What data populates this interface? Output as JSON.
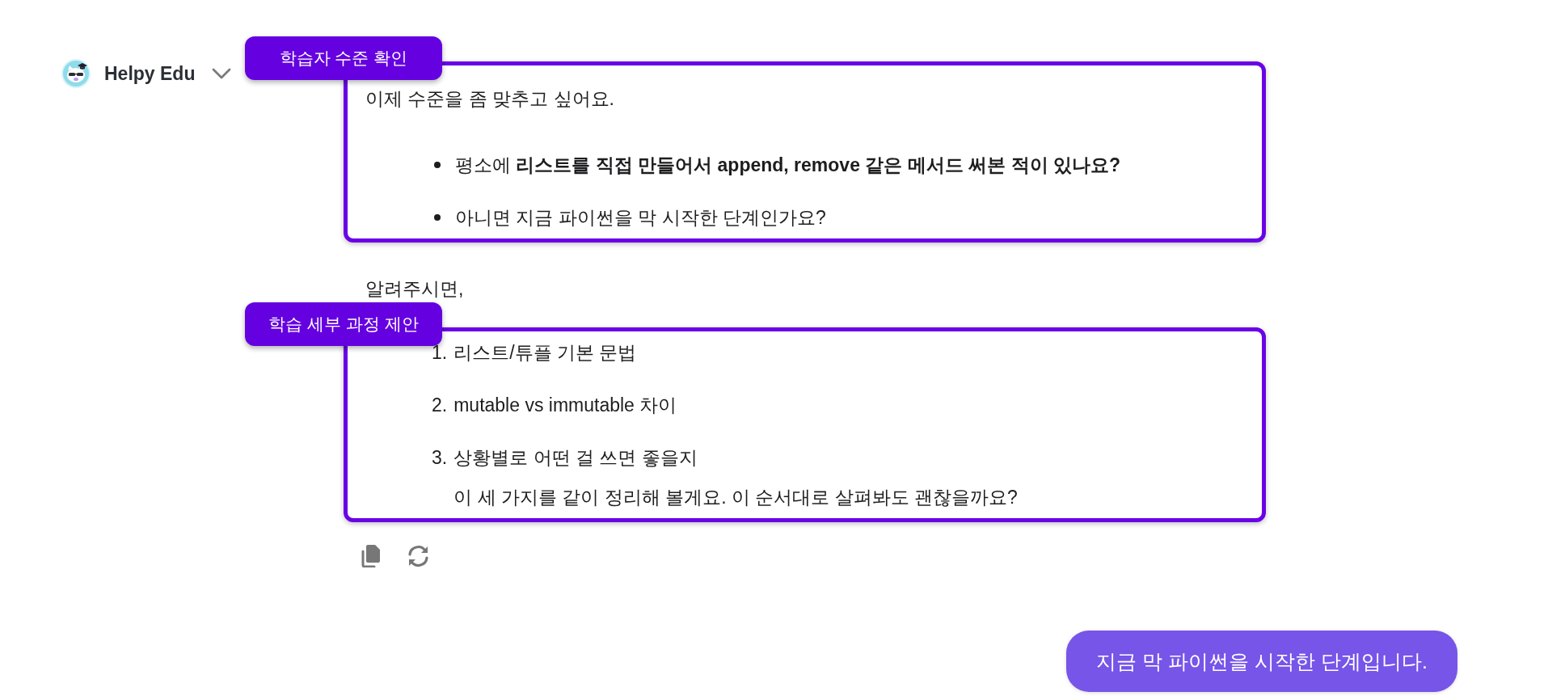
{
  "assistant": {
    "name": "Helpy Edu"
  },
  "message": {
    "sections": [
      {
        "kind": "annotated",
        "label": "학습자 수준 확인",
        "content": [
          {
            "kind": "paragraph",
            "text": "이제 수준을 좀 맞추고 싶어요."
          },
          {
            "kind": "bullets",
            "items": [
              {
                "text": "평소에 **리스트를 직접 만들어서 append, remove 같은 메서드 써본 적이 있나요?**"
              },
              {
                "text": "아니면 지금 파이썬을 막 시작한 단계인가요?"
              }
            ]
          }
        ]
      },
      {
        "kind": "plain",
        "content": [
          {
            "kind": "paragraph",
            "text": "알려주시면,"
          }
        ]
      },
      {
        "kind": "annotated",
        "label": "학습 세부 과정 제안",
        "content": [
          {
            "kind": "numbered",
            "items": [
              {
                "number": "1.",
                "text": "리스트/튜플 기본 문법"
              },
              {
                "number": "2.",
                "text": "mutable vs immutable 차이"
              },
              {
                "number": "3.",
                "text": "상황별로 어떤 걸 쓰면 좋을지",
                "second_line": "이 세 가지를 같이 정리해 볼게요. 이 순서대로 살펴봐도 괜찮을까요?"
              }
            ]
          }
        ]
      }
    ]
  },
  "user_message": {
    "text": "지금 막 파이썬을 시작한 단계입니다."
  }
}
